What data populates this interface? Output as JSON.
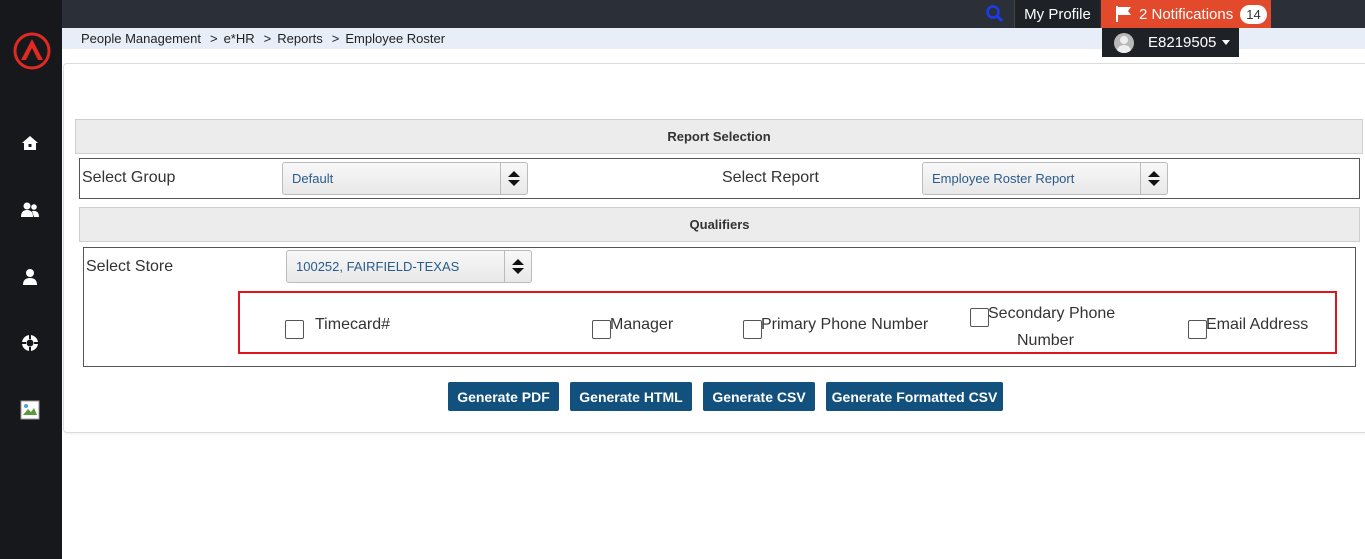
{
  "topbar": {
    "my_profile": "My Profile",
    "notifications_label": "2 Notifications",
    "notifications_count": "14",
    "user_id": "E8219505"
  },
  "breadcrumb": [
    "People Management",
    "e*HR",
    "Reports",
    "Employee Roster"
  ],
  "report_selection": {
    "title": "Report Selection",
    "group_label": "Select Group",
    "group_value": "Default",
    "report_label": "Select Report",
    "report_value": "Employee Roster Report"
  },
  "qualifiers": {
    "title": "Qualifiers",
    "store_label": "Select Store",
    "store_value": "100252, FAIRFIELD-TEXAS",
    "options": [
      "Timecard#",
      "Manager",
      "Primary Phone Number",
      "Secondary Phone",
      "Number",
      "Email Address"
    ]
  },
  "buttons": {
    "pdf": "Generate PDF",
    "html": "Generate HTML",
    "csv": "Generate CSV",
    "formatted_csv": "Generate Formatted CSV"
  },
  "colors": {
    "sidebar": "#17181c",
    "topbar": "#2b2f37",
    "notification": "#e24a2b",
    "button": "#12507d",
    "highlight": "#e0141e"
  },
  "icons": [
    "logo-icon",
    "home-icon",
    "users-icon",
    "user-icon",
    "support-icon",
    "broken-image-icon",
    "search-icon",
    "flag-icon"
  ]
}
